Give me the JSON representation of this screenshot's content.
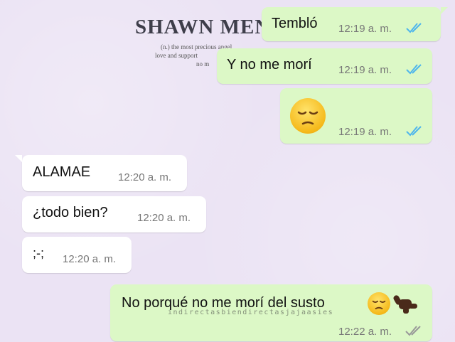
{
  "wallpaper": {
    "title": "SHAWN MEN",
    "line1": "(n.) the most precious angel",
    "line2": "love and support",
    "line3": "no m"
  },
  "messages": [
    {
      "direction": "out",
      "text": "Tembló",
      "time": "12:19 a. m.",
      "status": "read"
    },
    {
      "direction": "out",
      "text": "Y no me morí",
      "time": "12:19 a. m.",
      "status": "read"
    },
    {
      "direction": "out",
      "emoji": "pensive-face",
      "time": "12:19 a. m.",
      "status": "read"
    },
    {
      "direction": "in",
      "text": "ALAMAE",
      "time": "12:20 a. m."
    },
    {
      "direction": "in",
      "text": "¿todo bien?",
      "time": "12:20 a. m."
    },
    {
      "direction": "in",
      "text": ";-;",
      "time": "12:20 a. m."
    },
    {
      "direction": "out",
      "text": "No porqué no me morí del susto",
      "emojis": [
        "pensive-face",
        "call-me-hand"
      ],
      "time": "12:22 a. m.",
      "status": "delivered"
    }
  ],
  "watermark": "indirectasbiendirectasjajaasies",
  "colors": {
    "background": "#ebe3f4",
    "outgoing_bubble": "#dcf8c6",
    "incoming_bubble": "#ffffff",
    "read_ticks": "#4fb6ec",
    "delivered_ticks": "#999999"
  }
}
